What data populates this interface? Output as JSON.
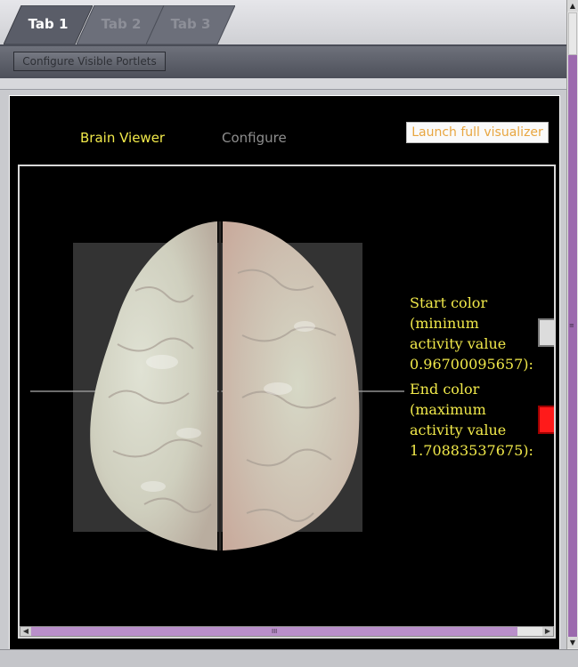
{
  "tabs": [
    {
      "label": "Tab 1",
      "active": true
    },
    {
      "label": "Tab 2",
      "active": false
    },
    {
      "label": "Tab 3",
      "active": false
    }
  ],
  "toolbar": {
    "configure_portlets_label": "Configure Visible Portlets"
  },
  "portlet": {
    "nav_brain_viewer": "Brain Viewer",
    "nav_configure": "Configure",
    "launch_label": "Launch full visualizer",
    "start_color": {
      "line1": "Start color",
      "line2": "(mininum",
      "line3": "activity value",
      "line4": "0.96700095657):",
      "swatch": "#dcdcdc"
    },
    "end_color": {
      "line1": "End color",
      "line2": "(maximum",
      "line3": "activity value",
      "line4": "1.70883537675):",
      "swatch": "#ff1a1a"
    }
  },
  "colors": {
    "accent_text": "#f1e94a",
    "launch_text": "#e8a640",
    "scrollbar": "#9c6aae"
  },
  "icons": {
    "scroll_left": "◀",
    "scroll_right": "▶",
    "scroll_up": "▲",
    "scroll_down": "▼",
    "grip": "III"
  }
}
